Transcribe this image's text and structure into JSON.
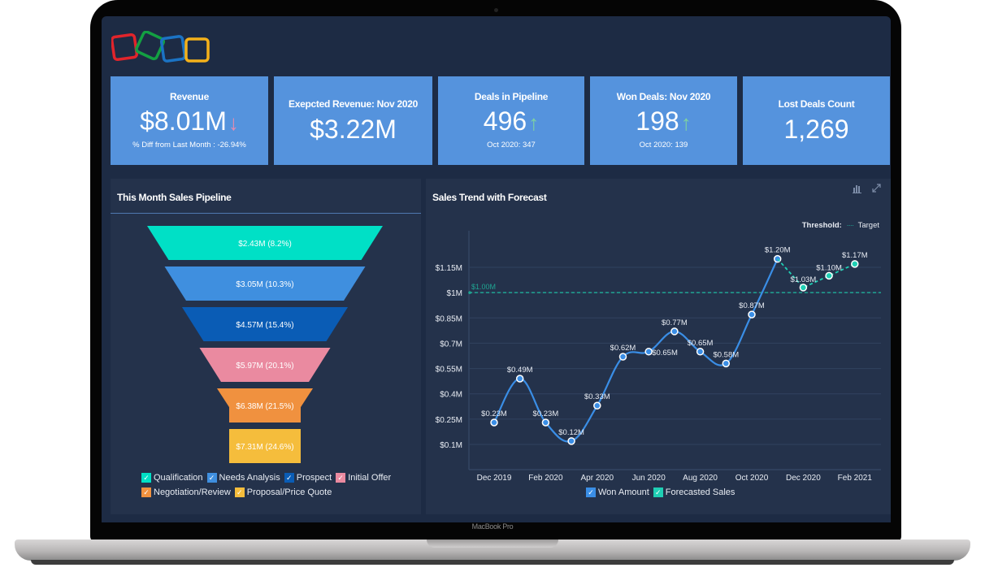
{
  "device": {
    "brand_label": "MacBook Pro"
  },
  "header": {
    "logo_name": "zoho-logo"
  },
  "kpis": [
    {
      "title": "Revenue",
      "value": "$8.01M",
      "trend": "down",
      "trend_glyph": "↓",
      "trend_color": "#e58cb0",
      "subtitle": "% Diff from Last Month : -26.94%"
    },
    {
      "title": "Exepcted Revenue: Nov 2020",
      "value": "$3.22M"
    },
    {
      "title": "Deals in Pipeline",
      "value": "496",
      "trend": "up",
      "trend_glyph": "↑",
      "trend_color": "#7fd3a0",
      "subtitle": "Oct 2020: 347"
    },
    {
      "title": "Won Deals: Nov 2020",
      "value": "198",
      "trend": "up",
      "trend_glyph": "↑",
      "trend_color": "#7fd3a0",
      "subtitle": "Oct 2020: 139"
    },
    {
      "title": "Lost Deals Count",
      "value": "1,269"
    }
  ],
  "pipeline": {
    "title": "This Month Sales Pipeline",
    "stages": [
      {
        "name": "Qualification",
        "label": "$2.43M (8.2%)",
        "value": 2.43,
        "percent": 8.2,
        "color": "#00e0c6"
      },
      {
        "name": "Needs Analysis",
        "label": "$3.05M (10.3%)",
        "value": 3.05,
        "percent": 10.3,
        "color": "#3f8fdf"
      },
      {
        "name": "Prospect",
        "label": "$4.57M (15.4%)",
        "value": 4.57,
        "percent": 15.4,
        "color": "#0a5cb5"
      },
      {
        "name": "Initial Offer",
        "label": "$5.97M (20.1%)",
        "value": 5.97,
        "percent": 20.1,
        "color": "#ea8aa0"
      },
      {
        "name": "Negotiation/Review",
        "label": "$6.38M (21.5%)",
        "value": 6.38,
        "percent": 21.5,
        "color": "#f0913f"
      },
      {
        "name": "Proposal/Price Quote",
        "label": "$7.31M (24.6%)",
        "value": 7.31,
        "percent": 24.6,
        "color": "#f5bd3c"
      }
    ]
  },
  "trend": {
    "title": "Sales Trend with Forecast",
    "threshold_label": "Threshold:",
    "threshold_name": "Target",
    "icons": [
      "bar-chart-icon",
      "expand-icon"
    ]
  },
  "chart_data": [
    {
      "type": "funnel",
      "title": "This Month Sales Pipeline",
      "categories": [
        "Qualification",
        "Needs Analysis",
        "Prospect",
        "Initial Offer",
        "Negotiation/Review",
        "Proposal/Price Quote"
      ],
      "values": [
        2.43,
        3.05,
        4.57,
        5.97,
        6.38,
        7.31
      ],
      "percents": [
        8.2,
        10.3,
        15.4,
        20.1,
        21.5,
        24.6
      ],
      "unit": "$M",
      "legend": "bottom"
    },
    {
      "type": "line",
      "title": "Sales Trend with Forecast",
      "x": [
        "Dec 2019",
        "Jan 2020",
        "Feb 2020",
        "Mar 2020",
        "Apr 2020",
        "May 2020",
        "Jun 2020",
        "Jul 2020",
        "Aug 2020",
        "Sep 2020",
        "Oct 2020",
        "Nov 2020",
        "Dec 2020",
        "Jan 2021",
        "Feb 2021"
      ],
      "xticks": [
        "Dec 2019",
        "Feb 2020",
        "Apr 2020",
        "Jun 2020",
        "Aug 2020",
        "Oct 2020",
        "Dec 2020",
        "Feb 2021"
      ],
      "yticks": [
        "$0.1M",
        "$0.25M",
        "$0.4M",
        "$0.55M",
        "$0.7M",
        "$0.85M",
        "$1M",
        "$1.15M"
      ],
      "ytick_values": [
        0.1,
        0.25,
        0.4,
        0.55,
        0.7,
        0.85,
        1.0,
        1.15
      ],
      "ylim": [
        0.1,
        1.15
      ],
      "series": [
        {
          "name": "Won Amount",
          "color": "#3a8ee6",
          "style": "solid",
          "values": [
            0.23,
            0.49,
            0.23,
            0.12,
            0.33,
            0.62,
            0.65,
            0.77,
            0.65,
            0.58,
            0.87,
            1.2,
            null,
            null,
            null
          ],
          "labels": [
            "$0.23M",
            "$0.49M",
            "$0.23M",
            "$0.12M",
            "$0.33M",
            "$0.62M",
            "$0.65M",
            "$0.77M",
            "$0.65M",
            "$0.58M",
            "$0.87M",
            "$1.20M",
            null,
            null,
            null
          ]
        },
        {
          "name": "Forecasted Sales",
          "color": "#1fcfb4",
          "style": "dashed",
          "values": [
            null,
            null,
            null,
            null,
            null,
            null,
            null,
            null,
            null,
            null,
            null,
            1.2,
            1.03,
            1.1,
            1.17
          ],
          "labels": [
            null,
            null,
            null,
            null,
            null,
            null,
            null,
            null,
            null,
            null,
            null,
            null,
            "$1.03M",
            "$1.10M",
            "$1.17M"
          ]
        }
      ],
      "threshold": {
        "name": "Target",
        "value": 1.0,
        "label": "$1.00M",
        "color": "#1fa592"
      },
      "legend": "bottom",
      "grid": true
    }
  ]
}
